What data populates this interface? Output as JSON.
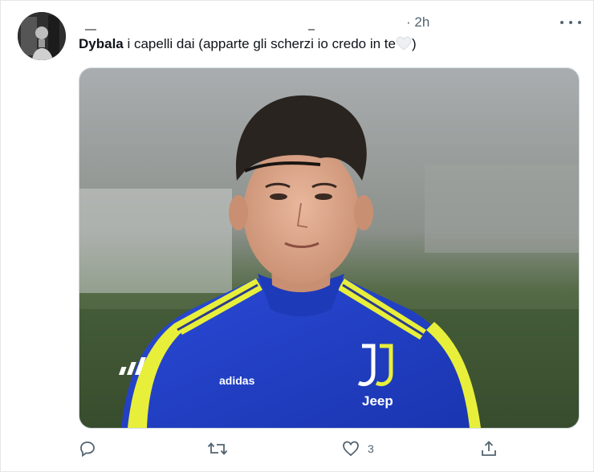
{
  "tweet": {
    "time": "· 2h",
    "text_bold": "Dybala",
    "text_parts": [
      " i capelli",
      " dai (apparte gli scherzi io credo in te",
      ")"
    ],
    "heart_emoji": "white-heart"
  },
  "photo": {
    "jersey_brand": "adidas",
    "jersey_sponsor": "Jeep",
    "colors": {
      "jersey": "#1f3fc4",
      "trim": "#e8ef3a",
      "background_green": "#3f5a33"
    }
  },
  "actions": {
    "reply_count": "",
    "retweet_count": "",
    "like_count": "3",
    "share_count": ""
  },
  "icons": [
    "more-icon",
    "reply-icon",
    "retweet-icon",
    "like-icon",
    "share-icon"
  ]
}
